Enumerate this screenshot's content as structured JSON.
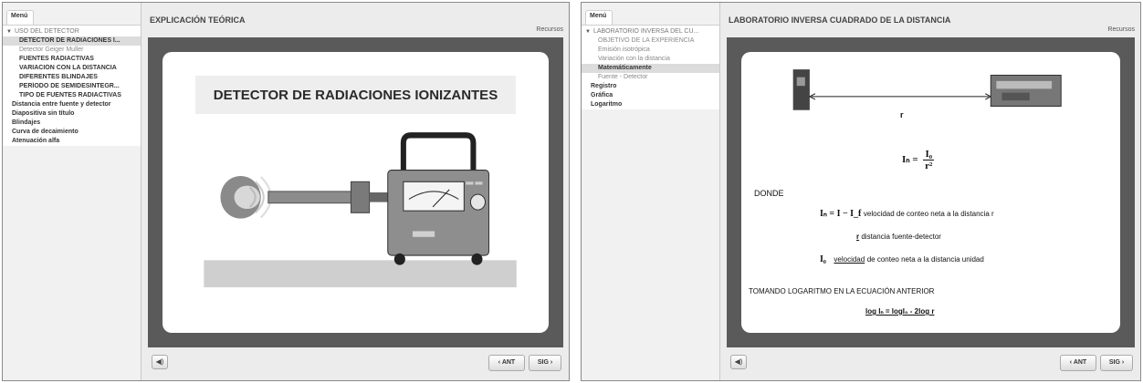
{
  "left": {
    "menu_tab": "Menú",
    "section": "USO DEL DETECTOR",
    "items": [
      "DETECTOR DE RADIACIONES I...",
      "Detector Geiger Muller",
      "FUENTES RADIACTIVAS",
      "VARIACIÓN CON LA DISTANCIA",
      "DIFERENTES BLINDAJES",
      "PERÍODO DE SEMIDESINTEGR...",
      "TIPO DE FUENTES RADIACTIVAS",
      "Distancia entre fuente y detector",
      "Diapositiva sin título",
      "Blindajes",
      "Curva de decaimiento",
      "Atenuación alfa"
    ],
    "title": "EXPLICACIÓN TEÓRICA",
    "recursos": "Recursos",
    "slide_title": "DETECTOR DE RADIACIONES IONIZANTES",
    "audio_icon": "speaker-icon",
    "ant": "‹ ANT",
    "sig": "SIG ›"
  },
  "right": {
    "menu_tab": "Menú",
    "section": "LABORATORIO INVERSA DEL CU...",
    "items": [
      "OBJETIVO DE LA EXPERIENCIA",
      "Emisión isotrópica",
      "Variación con la distancia",
      "Matemáticamente",
      "Fuente - Detector",
      "Registro",
      "Gráfica",
      "Logaritmo"
    ],
    "title": "LABORATORIO INVERSA CUADRADO DE LA DISTANCIA",
    "recursos": "Recursos",
    "r_label": "r",
    "formula_In": "Iₙ =",
    "formula_num": "I₀",
    "formula_den": "r²",
    "donde": "DONDE",
    "line1_math": "Iₙ = I − I_f",
    "line1_text": "velocidad de conteo neta a la distancia r",
    "line2_r": "r",
    "line2_text": "distancia fuente-detector",
    "line3_math": "I₀",
    "line3_word": "velocidad",
    "line3_text": "de conteo neta a la distancia unidad",
    "tomando": "TOMANDO LOGARITMO EN LA ECUACIÓN ANTERIOR",
    "log_eq": "log Iₙ = logI₀ - 2log r",
    "audio_icon": "speaker-icon",
    "ant": "‹ ANT",
    "sig": "SIG ›"
  }
}
